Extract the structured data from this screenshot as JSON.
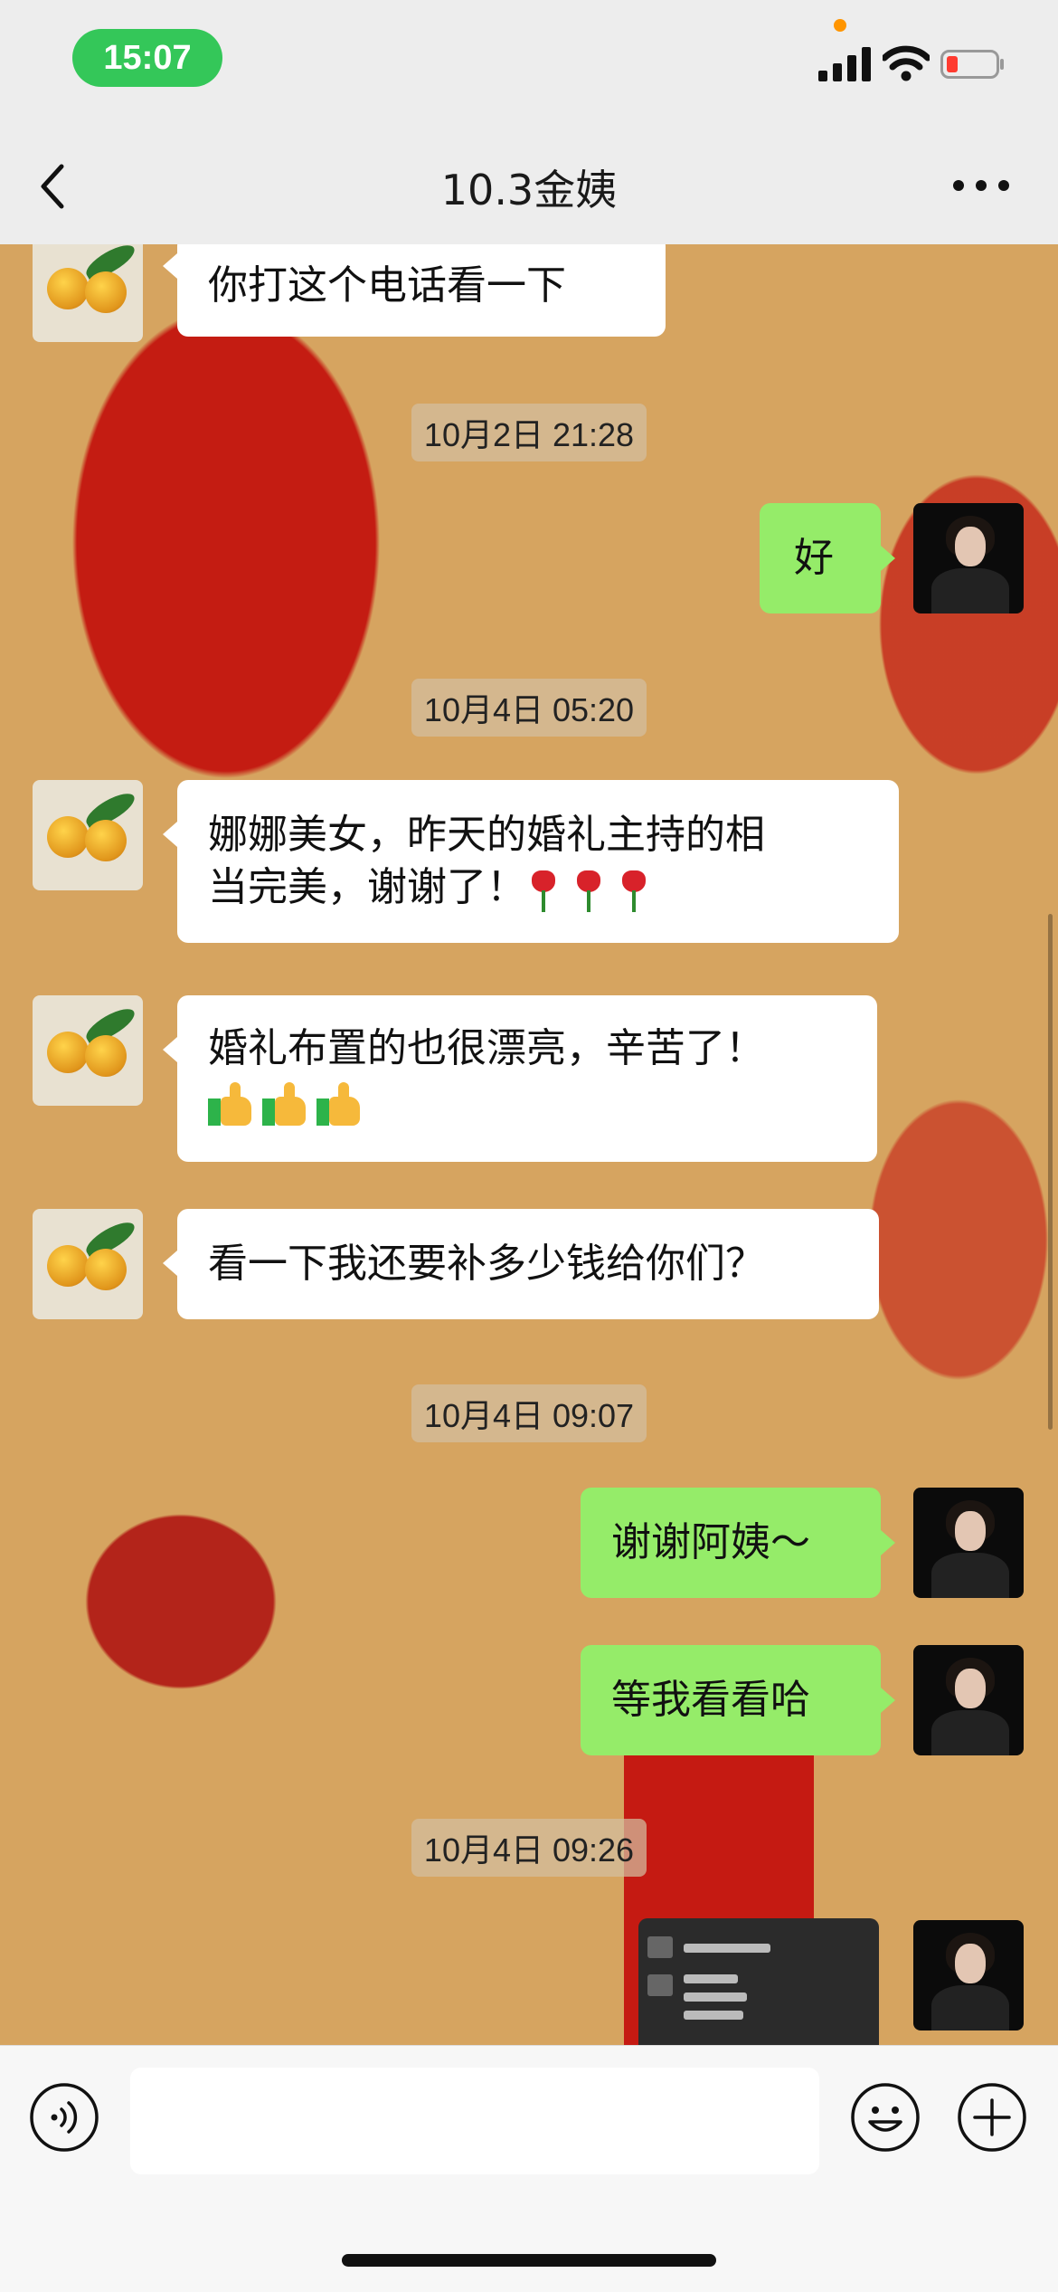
{
  "status_bar": {
    "time": "15:07",
    "colors": {
      "time_pill": "#34c759",
      "battery_low": "#ff3b30",
      "dot": "#ff9500"
    }
  },
  "nav": {
    "title": "10.3金姨",
    "back_icon": "chevron-left-icon",
    "more_icon": "more-icon"
  },
  "messages": [
    {
      "side": "left",
      "text": "你打这个电话看一下"
    },
    {
      "type": "time",
      "text": "10月2日 21:28"
    },
    {
      "side": "right",
      "text": "好"
    },
    {
      "type": "time",
      "text": "10月4日 05:20"
    },
    {
      "side": "left",
      "text_line1": "娜娜美女，昨天的婚礼主持的相",
      "text_line2": "当完美，谢谢了！",
      "emoji": "rose x3"
    },
    {
      "side": "left",
      "text_line1": "婚礼布置的也很漂亮，辛苦了！",
      "emoji": "thumbs-up x3"
    },
    {
      "side": "left",
      "text": "看一下我还要补多少钱给你们？"
    },
    {
      "type": "time",
      "text": "10月4日 09:07"
    },
    {
      "side": "right",
      "text": "谢谢阿姨～"
    },
    {
      "side": "right",
      "text": "等我看看哈"
    },
    {
      "type": "time",
      "text": "10月4日 09:26"
    },
    {
      "side": "right",
      "type": "image",
      "text": "image-thumbnail"
    }
  ],
  "input_bar": {
    "placeholder": "",
    "voice_icon": "voice-icon",
    "emoji_icon": "emoji-icon",
    "plus_icon": "plus-icon"
  },
  "colors": {
    "bubble_green": "#95ec69",
    "bubble_white": "#ffffff",
    "bar_bg": "#ededed"
  }
}
